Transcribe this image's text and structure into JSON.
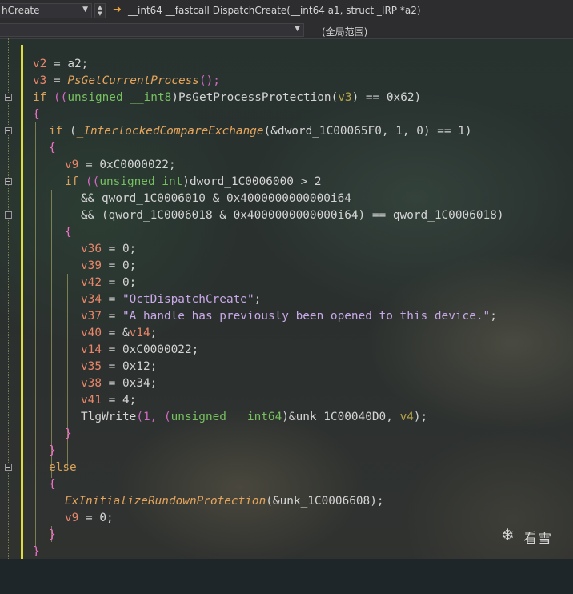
{
  "toolbar": {
    "function_combo": "hCreate",
    "signature": "__int64 __fastcall DispatchCreate(__int64 a1, struct _IRP *a2)",
    "scope": "(全局范围)"
  },
  "icons": {
    "dropdown": "chevron-down-icon",
    "spinner": "spinner-icon",
    "nav_arrow": "arrow-right-icon",
    "fold": "fold-minus-icon",
    "watermark": "snowflake-icon"
  },
  "colors": {
    "keyword": "#d8a25a",
    "variable": "#e8866a",
    "type": "#77c060",
    "function": "#e5a55c",
    "string": "#c8a8e8",
    "brace": "#f070c8",
    "change_bar": "#dcdc3c"
  },
  "code": {
    "l1": {
      "a": "v2",
      "b": " = a2;"
    },
    "l2": {
      "a": "v3",
      "b": " = ",
      "c": "PsGetCurrentProcess",
      "d": "();"
    },
    "l3": {
      "kw": "if",
      "p1": " ((",
      "ty": "unsigned __int8",
      "p2": ")PsGetProcessProtection(",
      "v": "v3",
      "p3": ") == 0x62)"
    },
    "l4": {
      "br": "{"
    },
    "l5": {
      "kw": "if",
      "p1": " (",
      "fn": "_InterlockedCompareExchange",
      "p2": "(&dword_1C00065F0, 1, 0) == 1)"
    },
    "l6": {
      "br": "{"
    },
    "l7": {
      "a": "v9",
      "b": " = 0xC0000022;"
    },
    "l8": {
      "kw": "if",
      "p1": " ((",
      "ty": "unsigned int",
      "p2": ")dword_1C0006000 > 2"
    },
    "l9": {
      "t": "&& qword_1C0006010 & 0x4000000000000i64"
    },
    "l10": {
      "t1": "&& (qword_1C0006018 & 0x4000000000000i64) == qword_1C0006018)"
    },
    "l11": {
      "br": "{"
    },
    "l12": {
      "a": "v36",
      "b": " = 0;"
    },
    "l13": {
      "a": "v39",
      "b": " = 0;"
    },
    "l14": {
      "a": "v42",
      "b": " = 0;"
    },
    "l15": {
      "a": "v34",
      "b": " = ",
      "s": "\"OctDispatchCreate\"",
      "e": ";"
    },
    "l16": {
      "a": "v37",
      "b": " = ",
      "s": "\"A handle has previously been opened to this device.\"",
      "e": ";"
    },
    "l17": {
      "a": "v40",
      "b": " = &",
      "c": "v14",
      "e": ";"
    },
    "l18": {
      "a": "v14",
      "b": " = 0xC0000022;"
    },
    "l19": {
      "a": "v35",
      "b": " = 0x12;"
    },
    "l20": {
      "a": "v38",
      "b": " = 0x34;"
    },
    "l21": {
      "a": "v41",
      "b": " = 4;"
    },
    "l22": {
      "f": "TlgWrite",
      "p1": "(1, (",
      "ty": "unsigned __int64",
      "p2": ")&unk_1C00040D0, ",
      "v": "v4",
      "p3": ");"
    },
    "l23": {
      "br": "}"
    },
    "l24": {
      "br": "}"
    },
    "l25": {
      "kw": "else"
    },
    "l26": {
      "br": "{"
    },
    "l27": {
      "fn": "ExInitializeRundownProtection",
      "p": "(&unk_1C0006608);"
    },
    "l28": {
      "a": "v9",
      "b": " = 0;"
    },
    "l29": {
      "br": "}"
    },
    "l30": {
      "br": "}"
    }
  },
  "watermark": {
    "text": "看雪"
  }
}
